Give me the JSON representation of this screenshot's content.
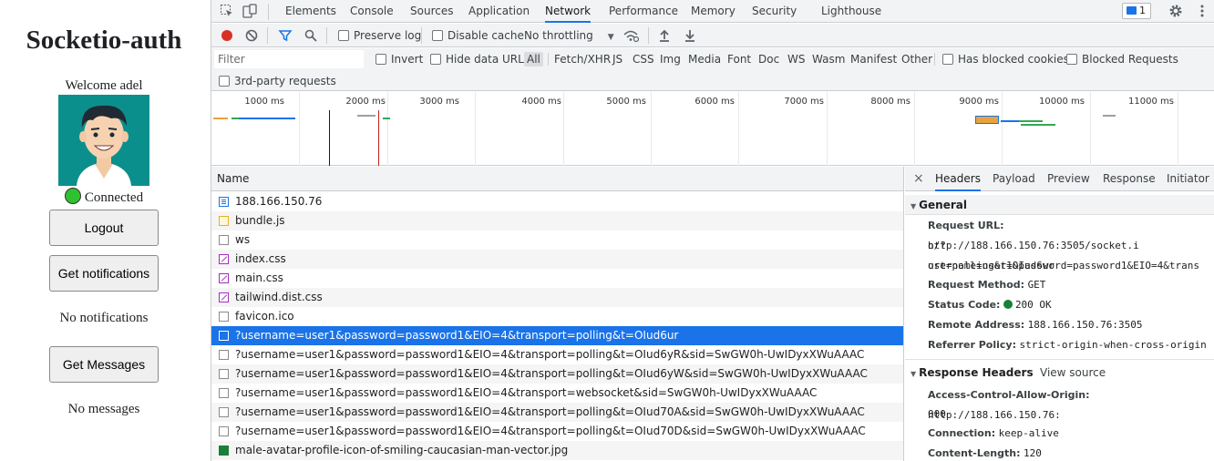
{
  "app": {
    "title": "Socketio-auth",
    "welcome": "Welcome adel",
    "connected": "Connected",
    "logout": "Logout",
    "get_notifications": "Get notifications",
    "no_notifications": "No notifications",
    "get_messages": "Get Messages",
    "no_messages": "No messages"
  },
  "devtools": {
    "tabs": [
      "Elements",
      "Console",
      "Sources",
      "Application",
      "Network",
      "Performance",
      "Memory",
      "Security",
      "Lighthouse"
    ],
    "active_tab": "Network",
    "issues_count": "1",
    "toolbar": {
      "preserve_log": "Preserve log",
      "disable_cache": "Disable cache",
      "throttling": "No throttling"
    },
    "filter": {
      "placeholder": "Filter",
      "invert": "Invert",
      "hide_data_urls": "Hide data URLs",
      "types": [
        "All",
        "Fetch/XHR",
        "JS",
        "CSS",
        "Img",
        "Media",
        "Font",
        "Doc",
        "WS",
        "Wasm",
        "Manifest",
        "Other"
      ],
      "has_blocked_cookies": "Has blocked cookies",
      "blocked_requests": "Blocked Requests",
      "third_party": "3rd-party requests"
    },
    "timeline_ticks": [
      "1000 ms",
      "2000 ms",
      "3000 ms",
      "4000 ms",
      "5000 ms",
      "6000 ms",
      "7000 ms",
      "8000 ms",
      "9000 ms",
      "10000 ms",
      "11000 ms"
    ],
    "list": {
      "header": "Name",
      "rows": [
        {
          "name": "188.166.150.76",
          "type": "doc"
        },
        {
          "name": "bundle.js",
          "type": "js"
        },
        {
          "name": "ws",
          "type": "other"
        },
        {
          "name": "index.css",
          "type": "css"
        },
        {
          "name": "main.css",
          "type": "css"
        },
        {
          "name": "tailwind.dist.css",
          "type": "css"
        },
        {
          "name": "favicon.ico",
          "type": "other"
        },
        {
          "name": "?username=user1&password=password1&EIO=4&transport=polling&t=OIud6ur",
          "type": "other",
          "selected": true
        },
        {
          "name": "?username=user1&password=password1&EIO=4&transport=polling&t=OIud6yR&sid=SwGW0h-UwIDyxXWuAAAC",
          "type": "other"
        },
        {
          "name": "?username=user1&password=password1&EIO=4&transport=polling&t=OIud6yW&sid=SwGW0h-UwIDyxXWuAAAC",
          "type": "other"
        },
        {
          "name": "?username=user1&password=password1&EIO=4&transport=websocket&sid=SwGW0h-UwIDyxXWuAAAC",
          "type": "other"
        },
        {
          "name": "?username=user1&password=password1&EIO=4&transport=polling&t=OIud70A&sid=SwGW0h-UwIDyxXWuAAAC",
          "type": "other"
        },
        {
          "name": "?username=user1&password=password1&EIO=4&transport=polling&t=OIud70D&sid=SwGW0h-UwIDyxXWuAAAC",
          "type": "other"
        },
        {
          "name": "male-avatar-profile-icon-of-smiling-caucasian-man-vector.jpg",
          "type": "img"
        }
      ]
    },
    "details": {
      "close": "×",
      "tabs": [
        "Headers",
        "Payload",
        "Preview",
        "Response",
        "Initiator"
      ],
      "active_tab": "Headers",
      "general": {
        "title": "General",
        "request_url_key": "Request URL:",
        "request_url_1": "http://188.166.150.76:3505/socket.i",
        "request_url_2": "o/?username=user1&password=password1&EIO=4&trans",
        "request_url_3": "ort=polling&t=OIud6ur",
        "request_method_key": "Request Method:",
        "request_method": "GET",
        "status_code_key": "Status Code:",
        "status_code": "200 OK",
        "remote_address_key": "Remote Address:",
        "remote_address": "188.166.150.76:3505",
        "referrer_policy_key": "Referrer Policy:",
        "referrer_policy": "strict-origin-when-cross-origin"
      },
      "response_headers": {
        "title": "Response Headers",
        "view_source": "View source",
        "acao_key": "Access-Control-Allow-Origin:",
        "acao_1": "http://188.166.150.76:",
        "acao_2": "000",
        "connection_key": "Connection:",
        "connection": "keep-alive",
        "content_length_key": "Content-Length:",
        "content_length": "120"
      }
    }
  }
}
